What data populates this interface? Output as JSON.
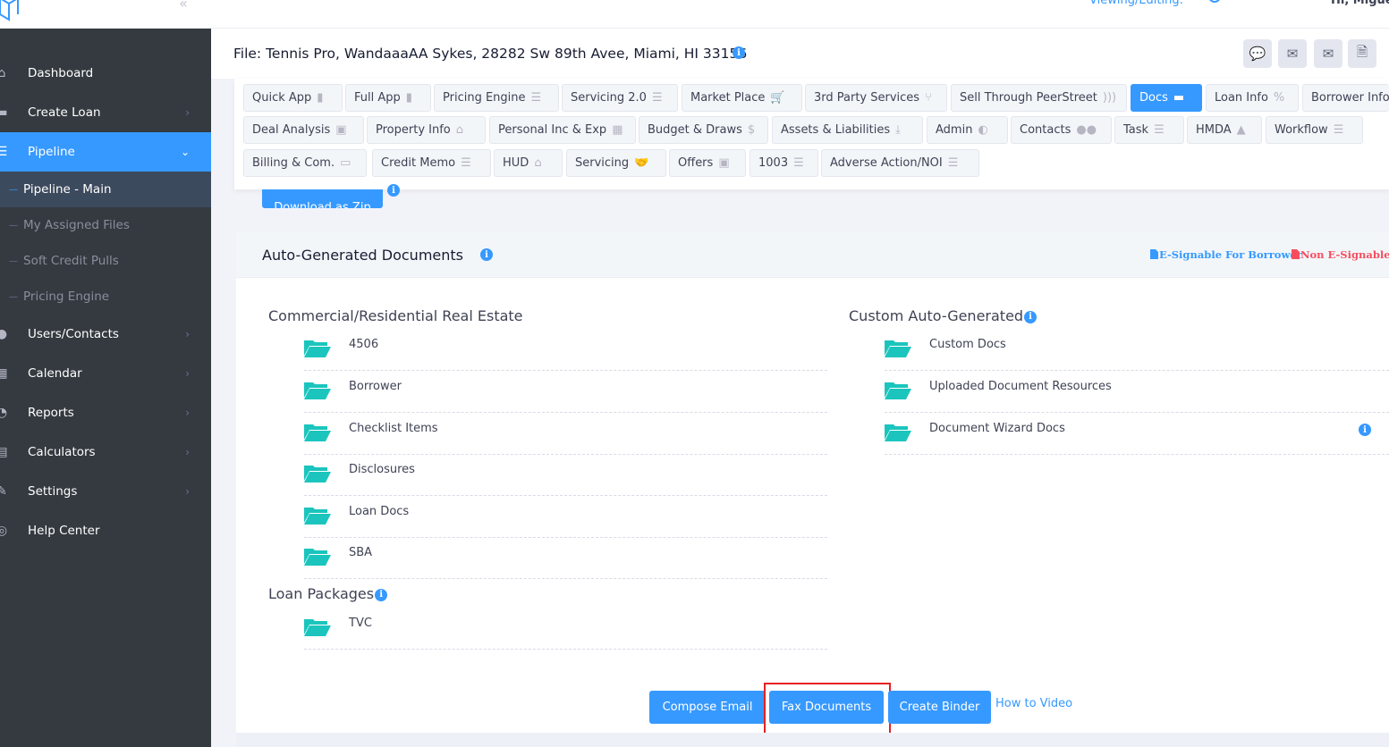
{
  "topbar": {
    "viewing_label": "Viewing/Editing:",
    "greeting": "Hi, Miguel"
  },
  "sidebar": {
    "items": [
      {
        "label": "Dashboard",
        "icon": "home-icon"
      },
      {
        "label": "Create Loan",
        "icon": "create-loan-icon"
      },
      {
        "label": "Pipeline",
        "icon": "pipeline-icon"
      },
      {
        "label": "Users/Contacts",
        "icon": "users-icon"
      },
      {
        "label": "Calendar",
        "icon": "calendar-icon"
      },
      {
        "label": "Reports",
        "icon": "reports-icon"
      },
      {
        "label": "Calculators",
        "icon": "calculator-icon"
      },
      {
        "label": "Settings",
        "icon": "settings-icon"
      },
      {
        "label": "Help Center",
        "icon": "help-icon"
      }
    ],
    "pipeline_sub": [
      "Pipeline - Main",
      "My Assigned Files",
      "Soft Credit Pulls",
      "Pricing Engine"
    ]
  },
  "file": {
    "title": "File: Tennis Pro, WandaaaAA Sykes, 28282 Sw 89th Avee, Miami, HI 33156"
  },
  "tabs": {
    "row1": [
      "Quick App",
      "Full App",
      "Pricing Engine",
      "Servicing 2.0",
      "Market Place",
      "3rd Party Services",
      "Sell Through PeerStreet",
      "Docs",
      "Loan Info",
      "Borrower Info"
    ],
    "row2": [
      "Deal Analysis",
      "Property Info",
      "Personal Inc & Exp",
      "Budget & Draws",
      "Assets & Liabilities",
      "Admin",
      "Contacts",
      "Task",
      "HMDA",
      "Workflow"
    ],
    "row3": [
      "Billing & Com.",
      "Credit Memo",
      "HUD",
      "Servicing",
      "Offers",
      "1003",
      "Adverse Action/NOI"
    ]
  },
  "download_label": "Download as Zip",
  "docs": {
    "card_title": "Auto-Generated Documents",
    "legend_esign": "E-Signable For Borrower",
    "legend_non_esign": "Non E-Signable F",
    "commercial_title": "Commercial/Residential Real Estate",
    "commercial_items": [
      "4506",
      "Borrower",
      "Checklist Items",
      "Disclosures",
      "Loan Docs",
      "SBA"
    ],
    "custom_title": "Custom Auto-Generated",
    "custom_items": [
      "Custom Docs",
      "Uploaded Document Resources",
      "Document Wizard Docs"
    ],
    "packages_title": "Loan Packages",
    "package_items": [
      "TVC"
    ]
  },
  "actions": {
    "compose_email": "Compose Email",
    "fax_documents": "Fax Documents",
    "create_binder": "Create Binder",
    "how_to_video": "How to Video"
  },
  "colors": {
    "primary": "#3699ff",
    "sidebar_bg": "#343a40",
    "folder": "#1bc5bd",
    "highlight": "#e52222"
  }
}
